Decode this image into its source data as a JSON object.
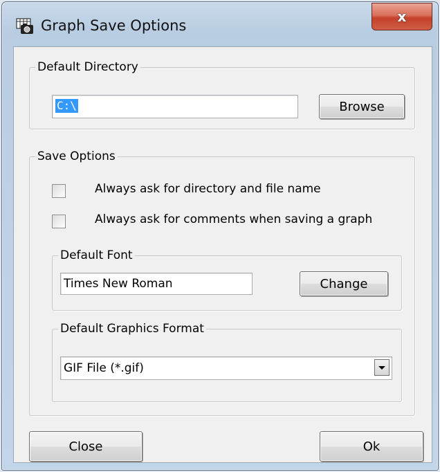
{
  "window": {
    "title": "Graph Save Options",
    "close_glyph": "x"
  },
  "default_directory": {
    "group_label": "Default Directory",
    "path_value": "C:\\",
    "browse_label": "Browse"
  },
  "save_options": {
    "group_label": "Save Options",
    "checkboxes": [
      {
        "label": "Always ask for directory and file name",
        "checked": false
      },
      {
        "label": "Always ask for comments when saving a graph",
        "checked": false
      }
    ],
    "default_font": {
      "group_label": "Default Font",
      "value": "Times New Roman",
      "change_label": "Change"
    },
    "graphics_format": {
      "group_label": "Default Graphics Format",
      "selected": "GIF File (*.gif)"
    }
  },
  "footer": {
    "close_label": "Close",
    "ok_label": "Ok"
  },
  "colors": {
    "selection": "#3399ff",
    "close_button": "#c4412a"
  }
}
